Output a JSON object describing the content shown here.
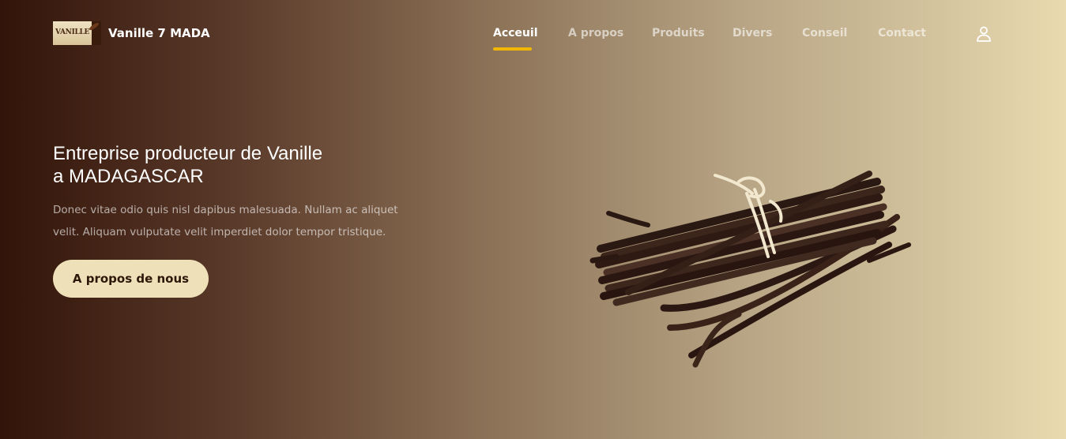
{
  "brand": {
    "logo_text": "VANILLE",
    "name": "Vanille 7 MADA"
  },
  "nav": {
    "items": [
      {
        "label": "Acceuil",
        "active": true
      },
      {
        "label": "A propos",
        "active": false
      },
      {
        "label": "Produits",
        "active": false
      },
      {
        "label": "Divers",
        "active": false
      },
      {
        "label": "Conseil",
        "active": false
      },
      {
        "label": "Contact",
        "active": false
      }
    ],
    "accent_color": "#f2b705",
    "user_icon": "user-icon"
  },
  "hero": {
    "title_line1": "Entreprise producteur de Vanille",
    "title_line2": "a MADAGASCAR",
    "description": "Donec vitae odio quis nisl dapibus malesuada. Nullam ac aliquet velit. Aliquam vulputate velit imperdiet dolor tempor tristique.",
    "button_label": "A propos de nous",
    "image_icon": "vanilla-bundle-image"
  },
  "colors": {
    "gradient_start": "#321409",
    "gradient_end": "#e9dab0",
    "button_bg": "#eee0b8",
    "button_text": "#2d1708"
  }
}
